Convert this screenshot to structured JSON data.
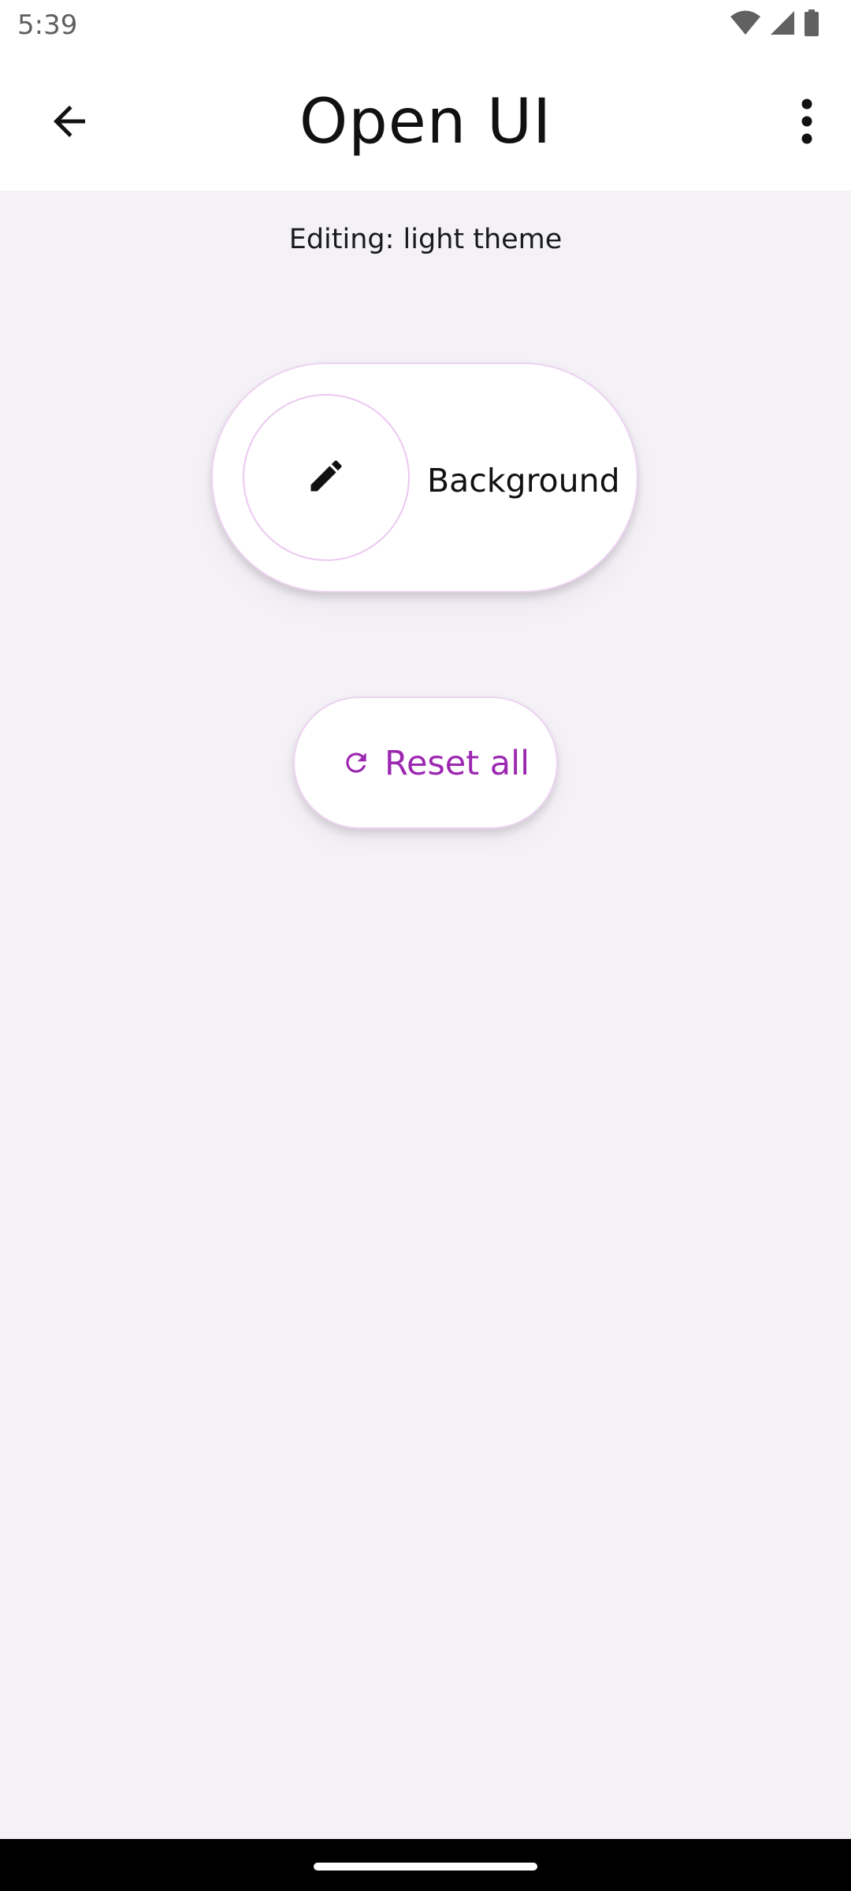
{
  "status_bar": {
    "time": "5:39",
    "icons": [
      "wifi-icon",
      "signal-icon",
      "battery-icon"
    ]
  },
  "app_bar": {
    "title": "Open UI",
    "back_icon": "arrow-back-icon",
    "menu_icon": "more-vert-icon"
  },
  "editor": {
    "editing_label": "Editing: light theme",
    "background_button": {
      "label": "Background",
      "icon": "edit-pencil-icon"
    },
    "reset_button": {
      "label": "Reset all",
      "icon": "refresh-icon"
    }
  },
  "colors": {
    "accent": "#9c27b0",
    "background": "#f4f2f6",
    "surface": "#ffffff",
    "outline": "#ecd3f0"
  }
}
